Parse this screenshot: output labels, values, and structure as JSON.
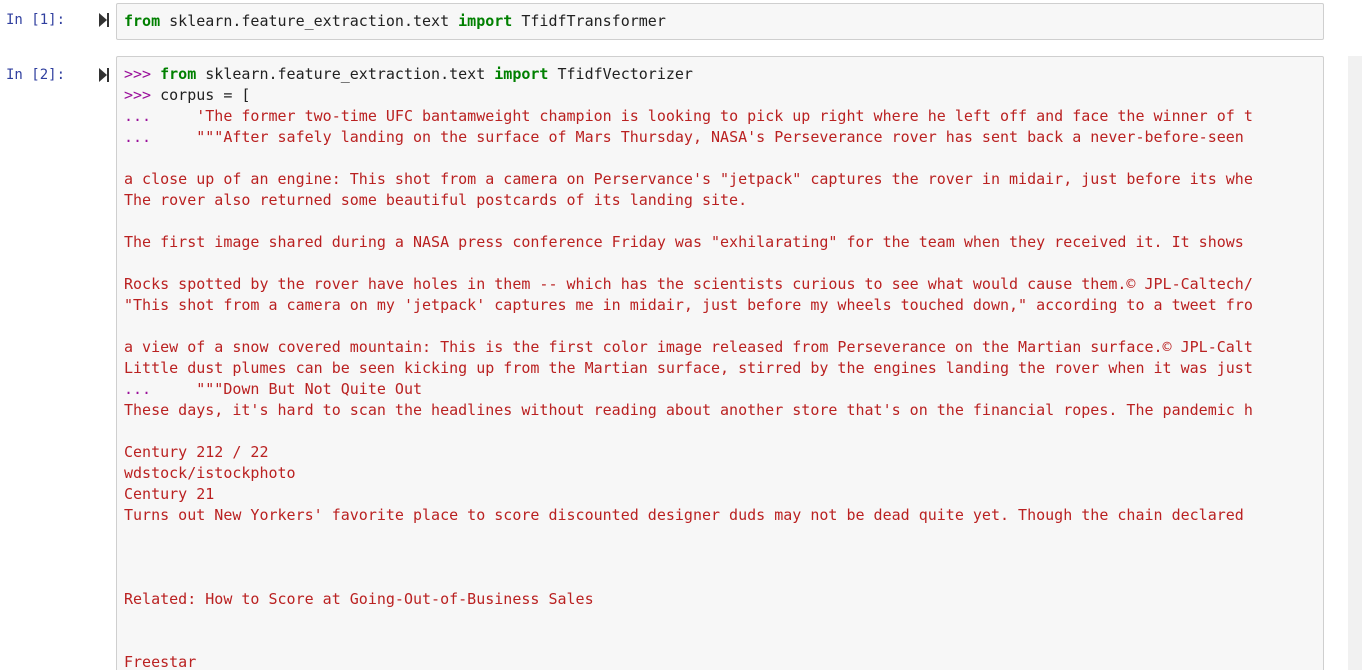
{
  "cells": [
    {
      "prompt": "In [1]:",
      "lines": [
        [
          [
            "kw",
            "from"
          ],
          [
            "o",
            " sklearn.feature_extraction.text "
          ],
          [
            "kw",
            "import"
          ],
          [
            "o",
            " TfidfTransformer"
          ]
        ]
      ]
    },
    {
      "prompt": "In [2]:",
      "lines": [
        [
          [
            "pr",
            ">>> "
          ],
          [
            "kw",
            "from"
          ],
          [
            "o",
            " sklearn.feature_extraction.text "
          ],
          [
            "kw",
            "import"
          ],
          [
            "o",
            " TfidfVectorizer"
          ]
        ],
        [
          [
            "pr",
            ">>> "
          ],
          [
            "o",
            "corpus = ["
          ]
        ],
        [
          [
            "pr",
            "...     "
          ],
          [
            "s",
            "'The former two-time UFC bantamweight champion is looking to pick up right where he left off and face the winner of t"
          ]
        ],
        [
          [
            "pr",
            "...     "
          ],
          [
            "s",
            "\"\"\"After safely landing on the surface of Mars Thursday, NASA's Perseverance rover has sent back a never-before-seen"
          ]
        ],
        [],
        [
          [
            "s",
            "a close up of an engine: This shot from a camera on Perservance's \"jetpack\" captures the rover in midair, just before its whe"
          ]
        ],
        [
          [
            "s",
            "The rover also returned some beautiful postcards of its landing site."
          ]
        ],
        [],
        [
          [
            "s",
            "The first image shared during a NASA press conference Friday was \"exhilarating\" for the team when they received it. It shows"
          ]
        ],
        [],
        [
          [
            "s",
            "Rocks spotted by the rover have holes in them -- which has the scientists curious to see what would cause them.© JPL-Caltech/"
          ]
        ],
        [
          [
            "s",
            "\"This shot from a camera on my 'jetpack' captures me in midair, just before my wheels touched down,\" according to a tweet fro"
          ]
        ],
        [],
        [
          [
            "s",
            "a view of a snow covered mountain: This is the first color image released from Perseverance on the Martian surface.© JPL-Calt"
          ]
        ],
        [
          [
            "s",
            "Little dust plumes can be seen kicking up from the Martian surface, stirred by the engines landing the rover when it was just"
          ]
        ],
        [
          [
            "pr",
            "...     "
          ],
          [
            "s",
            "\"\"\"Down But Not Quite Out"
          ]
        ],
        [
          [
            "s",
            "These days, it's hard to scan the headlines without reading about another store that's on the financial ropes. The pandemic h"
          ]
        ],
        [],
        [
          [
            "s",
            "Century 212 / 22"
          ]
        ],
        [
          [
            "s",
            "wdstock/istockphoto"
          ]
        ],
        [
          [
            "s",
            "Century 21"
          ]
        ],
        [
          [
            "s",
            "Turns out New Yorkers' favorite place to score discounted designer duds may not be dead quite yet. Though the chain declared"
          ]
        ],
        [],
        [],
        [],
        [
          [
            "s",
            "Related: How to Score at Going-Out-of-Business Sales"
          ]
        ],
        [],
        [],
        [
          [
            "s",
            "Freestar"
          ]
        ]
      ]
    }
  ]
}
